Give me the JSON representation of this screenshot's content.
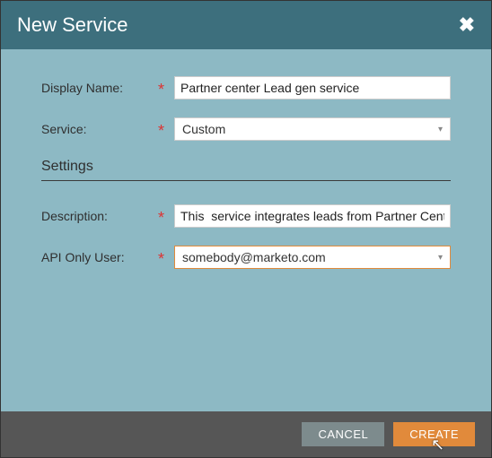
{
  "dialog": {
    "title": "New Service"
  },
  "form": {
    "displayName": {
      "label": "Display Name:",
      "value": "Partner center Lead gen service"
    },
    "service": {
      "label": "Service:",
      "value": "Custom"
    },
    "sectionTitle": "Settings",
    "description": {
      "label": "Description:",
      "value": "This  service integrates leads from Partner Center"
    },
    "apiUser": {
      "label": "API Only User:",
      "value": "somebody@marketo.com"
    }
  },
  "footer": {
    "cancel": "CANCEL",
    "create": "CREATE"
  }
}
